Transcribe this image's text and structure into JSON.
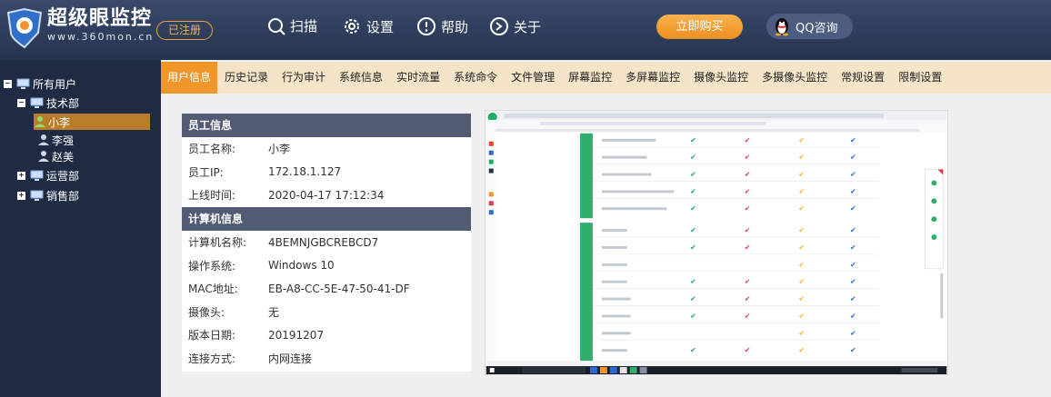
{
  "header": {
    "brand_title": "超级眼监控",
    "brand_url": "www.360mon.cn",
    "registered_badge": "已注册",
    "nav": [
      {
        "label": "扫描",
        "icon": "scan-icon"
      },
      {
        "label": "设置",
        "icon": "gear-icon"
      },
      {
        "label": "帮助",
        "icon": "help-icon"
      },
      {
        "label": "关于",
        "icon": "about-icon"
      }
    ],
    "buy_label": "立即购买",
    "qq_label": "QQ咨询"
  },
  "sidebar": {
    "root": "所有用户",
    "groups": [
      {
        "label": "技术部",
        "users": [
          "小李",
          "李强",
          "赵美"
        ]
      },
      {
        "label": "运营部"
      },
      {
        "label": "销售部"
      }
    ],
    "selected_user": "小李"
  },
  "tabs": [
    "用户信息",
    "历史记录",
    "行为审计",
    "系统信息",
    "实时流量",
    "系统命令",
    "文件管理",
    "屏幕监控",
    "多屏幕监控",
    "摄像头监控",
    "多摄像头监控",
    "常规设置",
    "限制设置"
  ],
  "active_tab": "用户信息",
  "employee": {
    "section_title": "员工信息",
    "rows": [
      {
        "label": "员工名称:",
        "value": "小李"
      },
      {
        "label": "员工IP:",
        "value": "172.18.1.127"
      },
      {
        "label": "上线时间:",
        "value": "2020-04-17 17:12:34"
      }
    ]
  },
  "computer": {
    "section_title": "计算机信息",
    "rows": [
      {
        "label": "计算机名称:",
        "value": "4BEMNJGBCREBCD7"
      },
      {
        "label": "操作系统:",
        "value": "Windows 10"
      },
      {
        "label": "MAC地址:",
        "value": "EB-A8-CC-5E-47-50-41-DF"
      },
      {
        "label": "摄像头:",
        "value": "无"
      },
      {
        "label": "版本日期:",
        "value": "20191207"
      },
      {
        "label": "连接方式:",
        "value": "内网连接"
      }
    ]
  },
  "colors": {
    "header_bg": "#2d3b5a",
    "sidebar_bg": "#1f2b42",
    "accent_orange": "#f0962a",
    "tab_bar_bg": "#f4e5c9",
    "section_bg": "#515b73"
  }
}
